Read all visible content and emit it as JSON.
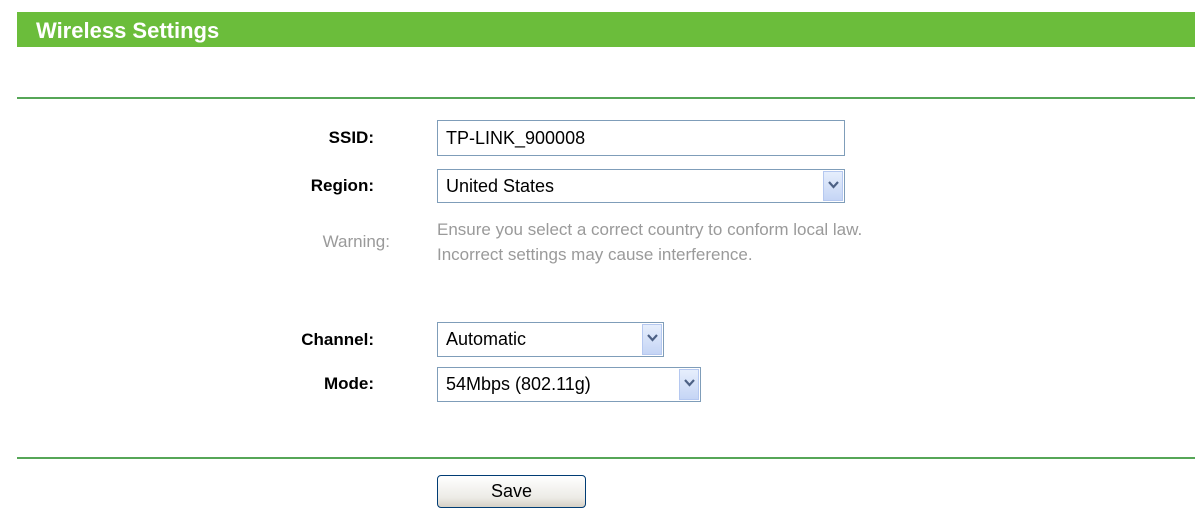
{
  "header": {
    "title": "Wireless Settings"
  },
  "form": {
    "ssid": {
      "label": "SSID:",
      "value": "TP-LINK_900008"
    },
    "region": {
      "label": "Region:",
      "selected": "United States"
    },
    "warning": {
      "label": "Warning:",
      "line1": "Ensure you select a correct country to conform local law.",
      "line2": "Incorrect settings may cause interference."
    },
    "channel": {
      "label": "Channel:",
      "selected": "Automatic"
    },
    "mode": {
      "label": "Mode:",
      "selected": "54Mbps (802.11g)"
    }
  },
  "actions": {
    "save_label": "Save"
  },
  "colors": {
    "header_bg": "#6bbd3b",
    "divider": "#56a657",
    "muted_text": "#9a9a9a"
  }
}
